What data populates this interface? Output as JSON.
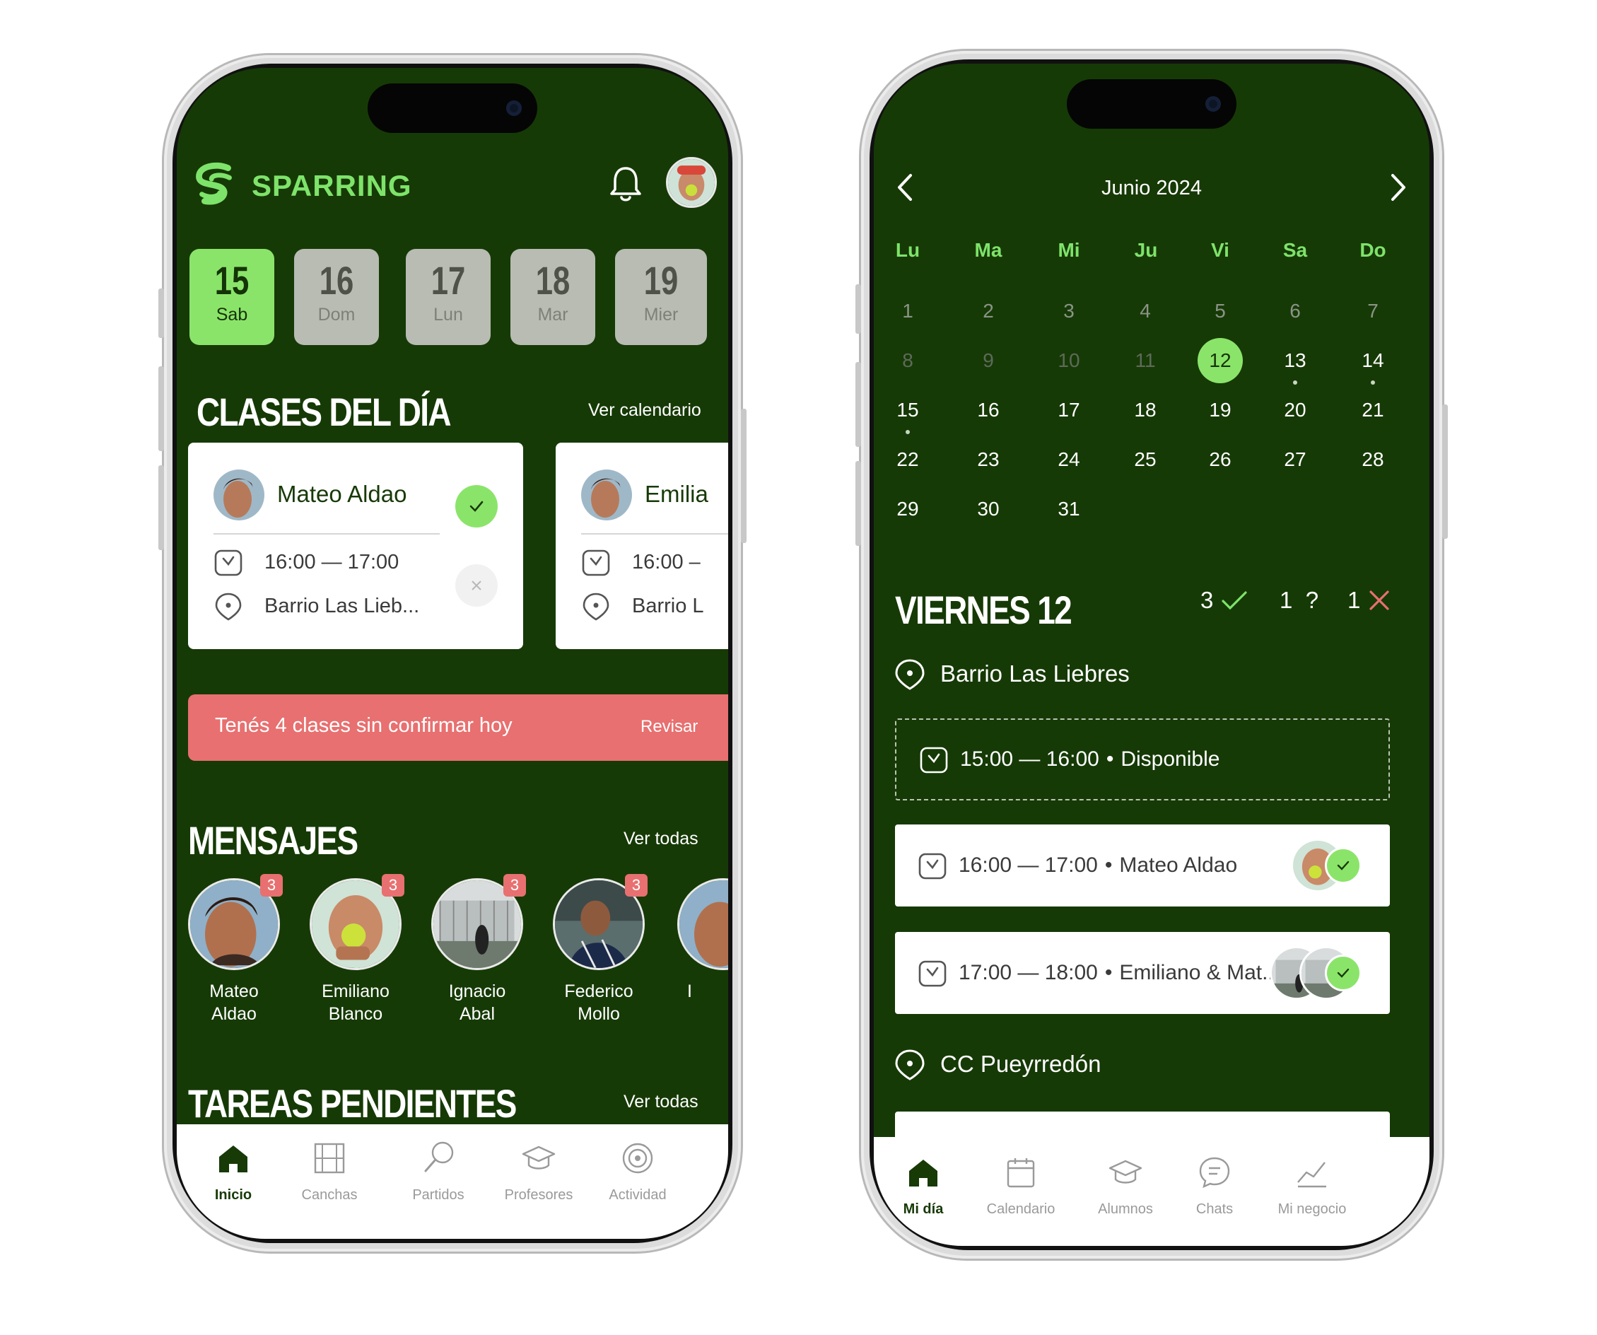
{
  "phone1": {
    "brand": "SPARRING",
    "days": [
      {
        "num": "15",
        "label": "Sab",
        "active": true
      },
      {
        "num": "16",
        "label": "Dom",
        "active": false
      },
      {
        "num": "17",
        "label": "Lun",
        "active": false
      },
      {
        "num": "18",
        "label": "Mar",
        "active": false
      },
      {
        "num": "19",
        "label": "Mier",
        "active": false
      }
    ],
    "classes_title": "CLASES DEL DÍA",
    "classes_link": "Ver calendario",
    "class_cards": [
      {
        "name": "Mateo Aldao",
        "time": "16:00 — 17:00",
        "location": "Barrio Las Lieb..."
      },
      {
        "name": "Emilia",
        "time": "16:00 –",
        "location": "Barrio L"
      }
    ],
    "alert": {
      "text": "Tenés 4 clases sin confirmar hoy",
      "action": "Revisar"
    },
    "messages_title": "MENSAJES",
    "messages_link": "Ver todas",
    "messages": [
      {
        "first": "Mateo",
        "last": "Aldao",
        "badge": "3"
      },
      {
        "first": "Emiliano",
        "last": "Blanco",
        "badge": "3"
      },
      {
        "first": "Ignacio",
        "last": "Abal",
        "badge": "3"
      },
      {
        "first": "Federico",
        "last": "Mollo",
        "badge": "3"
      },
      {
        "first": "I",
        "last": "",
        "badge": ""
      }
    ],
    "tasks_title": "TAREAS PENDIENTES",
    "tasks_link": "Ver todas",
    "tabs": [
      "Inicio",
      "Canchas",
      "Partidos",
      "Profesores",
      "Actividad"
    ]
  },
  "phone2": {
    "month": "Junio 2024",
    "weekdays": [
      "Lu",
      "Ma",
      "Mi",
      "Ju",
      "Vi",
      "Sa",
      "Do"
    ],
    "day_title": "VIERNES 12",
    "stats": {
      "confirmed": "3",
      "pending": "1",
      "pending_mark": "?",
      "cancelled": "1"
    },
    "locations": [
      {
        "name": "Barrio Las Liebres",
        "slots": [
          {
            "time": "15:00 — 16:00",
            "who": "Disponible",
            "available": true
          },
          {
            "time": "16:00 — 17:00",
            "who": "Mateo Aldao",
            "available": false
          },
          {
            "time": "17:00 — 18:00",
            "who": "Emiliano & Mat..",
            "available": false
          }
        ]
      },
      {
        "name": "CC Pueyrredón",
        "slots": []
      }
    ],
    "tabs": [
      "Mi día",
      "Calendario",
      "Alumnos",
      "Chats",
      "Mi negocio"
    ]
  },
  "colors": {
    "bg": "#163a06",
    "accent": "#8be46a",
    "alert": "#e87070"
  }
}
